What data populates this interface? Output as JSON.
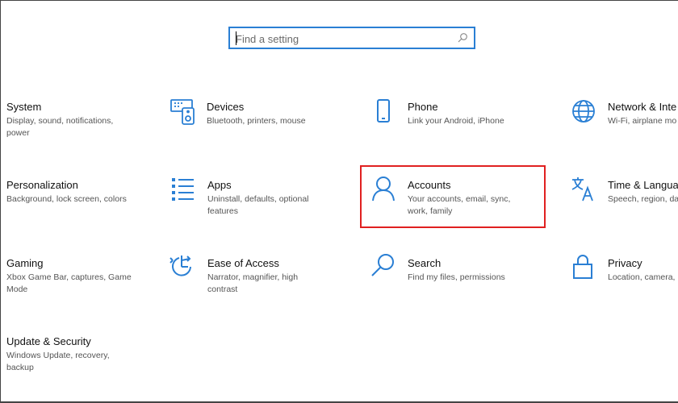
{
  "search": {
    "placeholder": "Find a setting",
    "icon": "search-icon"
  },
  "colors": {
    "accent": "#2a7fd4",
    "highlight": "#e02020"
  },
  "tiles": [
    {
      "title": "System",
      "desc": "Display, sound, notifications, power",
      "icon": ""
    },
    {
      "title": "Devices",
      "desc": "Bluetooth, printers, mouse",
      "icon": "keyboard-speaker-icon"
    },
    {
      "title": "Phone",
      "desc": "Link your Android, iPhone",
      "icon": "phone-icon"
    },
    {
      "title": "Network & Inte",
      "desc": "Wi-Fi, airplane mo",
      "icon": "globe-icon"
    },
    {
      "title": "Personalization",
      "desc": "Background, lock screen, colors",
      "icon": ""
    },
    {
      "title": "Apps",
      "desc": "Uninstall, defaults, optional features",
      "icon": "apps-list-icon"
    },
    {
      "title": "Accounts",
      "desc": "Your accounts, email, sync, work, family",
      "icon": "person-icon"
    },
    {
      "title": "Time & Languag",
      "desc": "Speech, region, da",
      "icon": "language-icon"
    },
    {
      "title": "Gaming",
      "desc": "Xbox Game Bar, captures, Game Mode",
      "icon": ""
    },
    {
      "title": "Ease of Access",
      "desc": "Narrator, magnifier, high contrast",
      "icon": "ease-of-access-icon"
    },
    {
      "title": "Search",
      "desc": "Find my files, permissions",
      "icon": "magnifier-icon"
    },
    {
      "title": "Privacy",
      "desc": "Location, camera,",
      "icon": "lock-icon"
    },
    {
      "title": "Update & Security",
      "desc": "Windows Update, recovery, backup",
      "icon": ""
    }
  ]
}
